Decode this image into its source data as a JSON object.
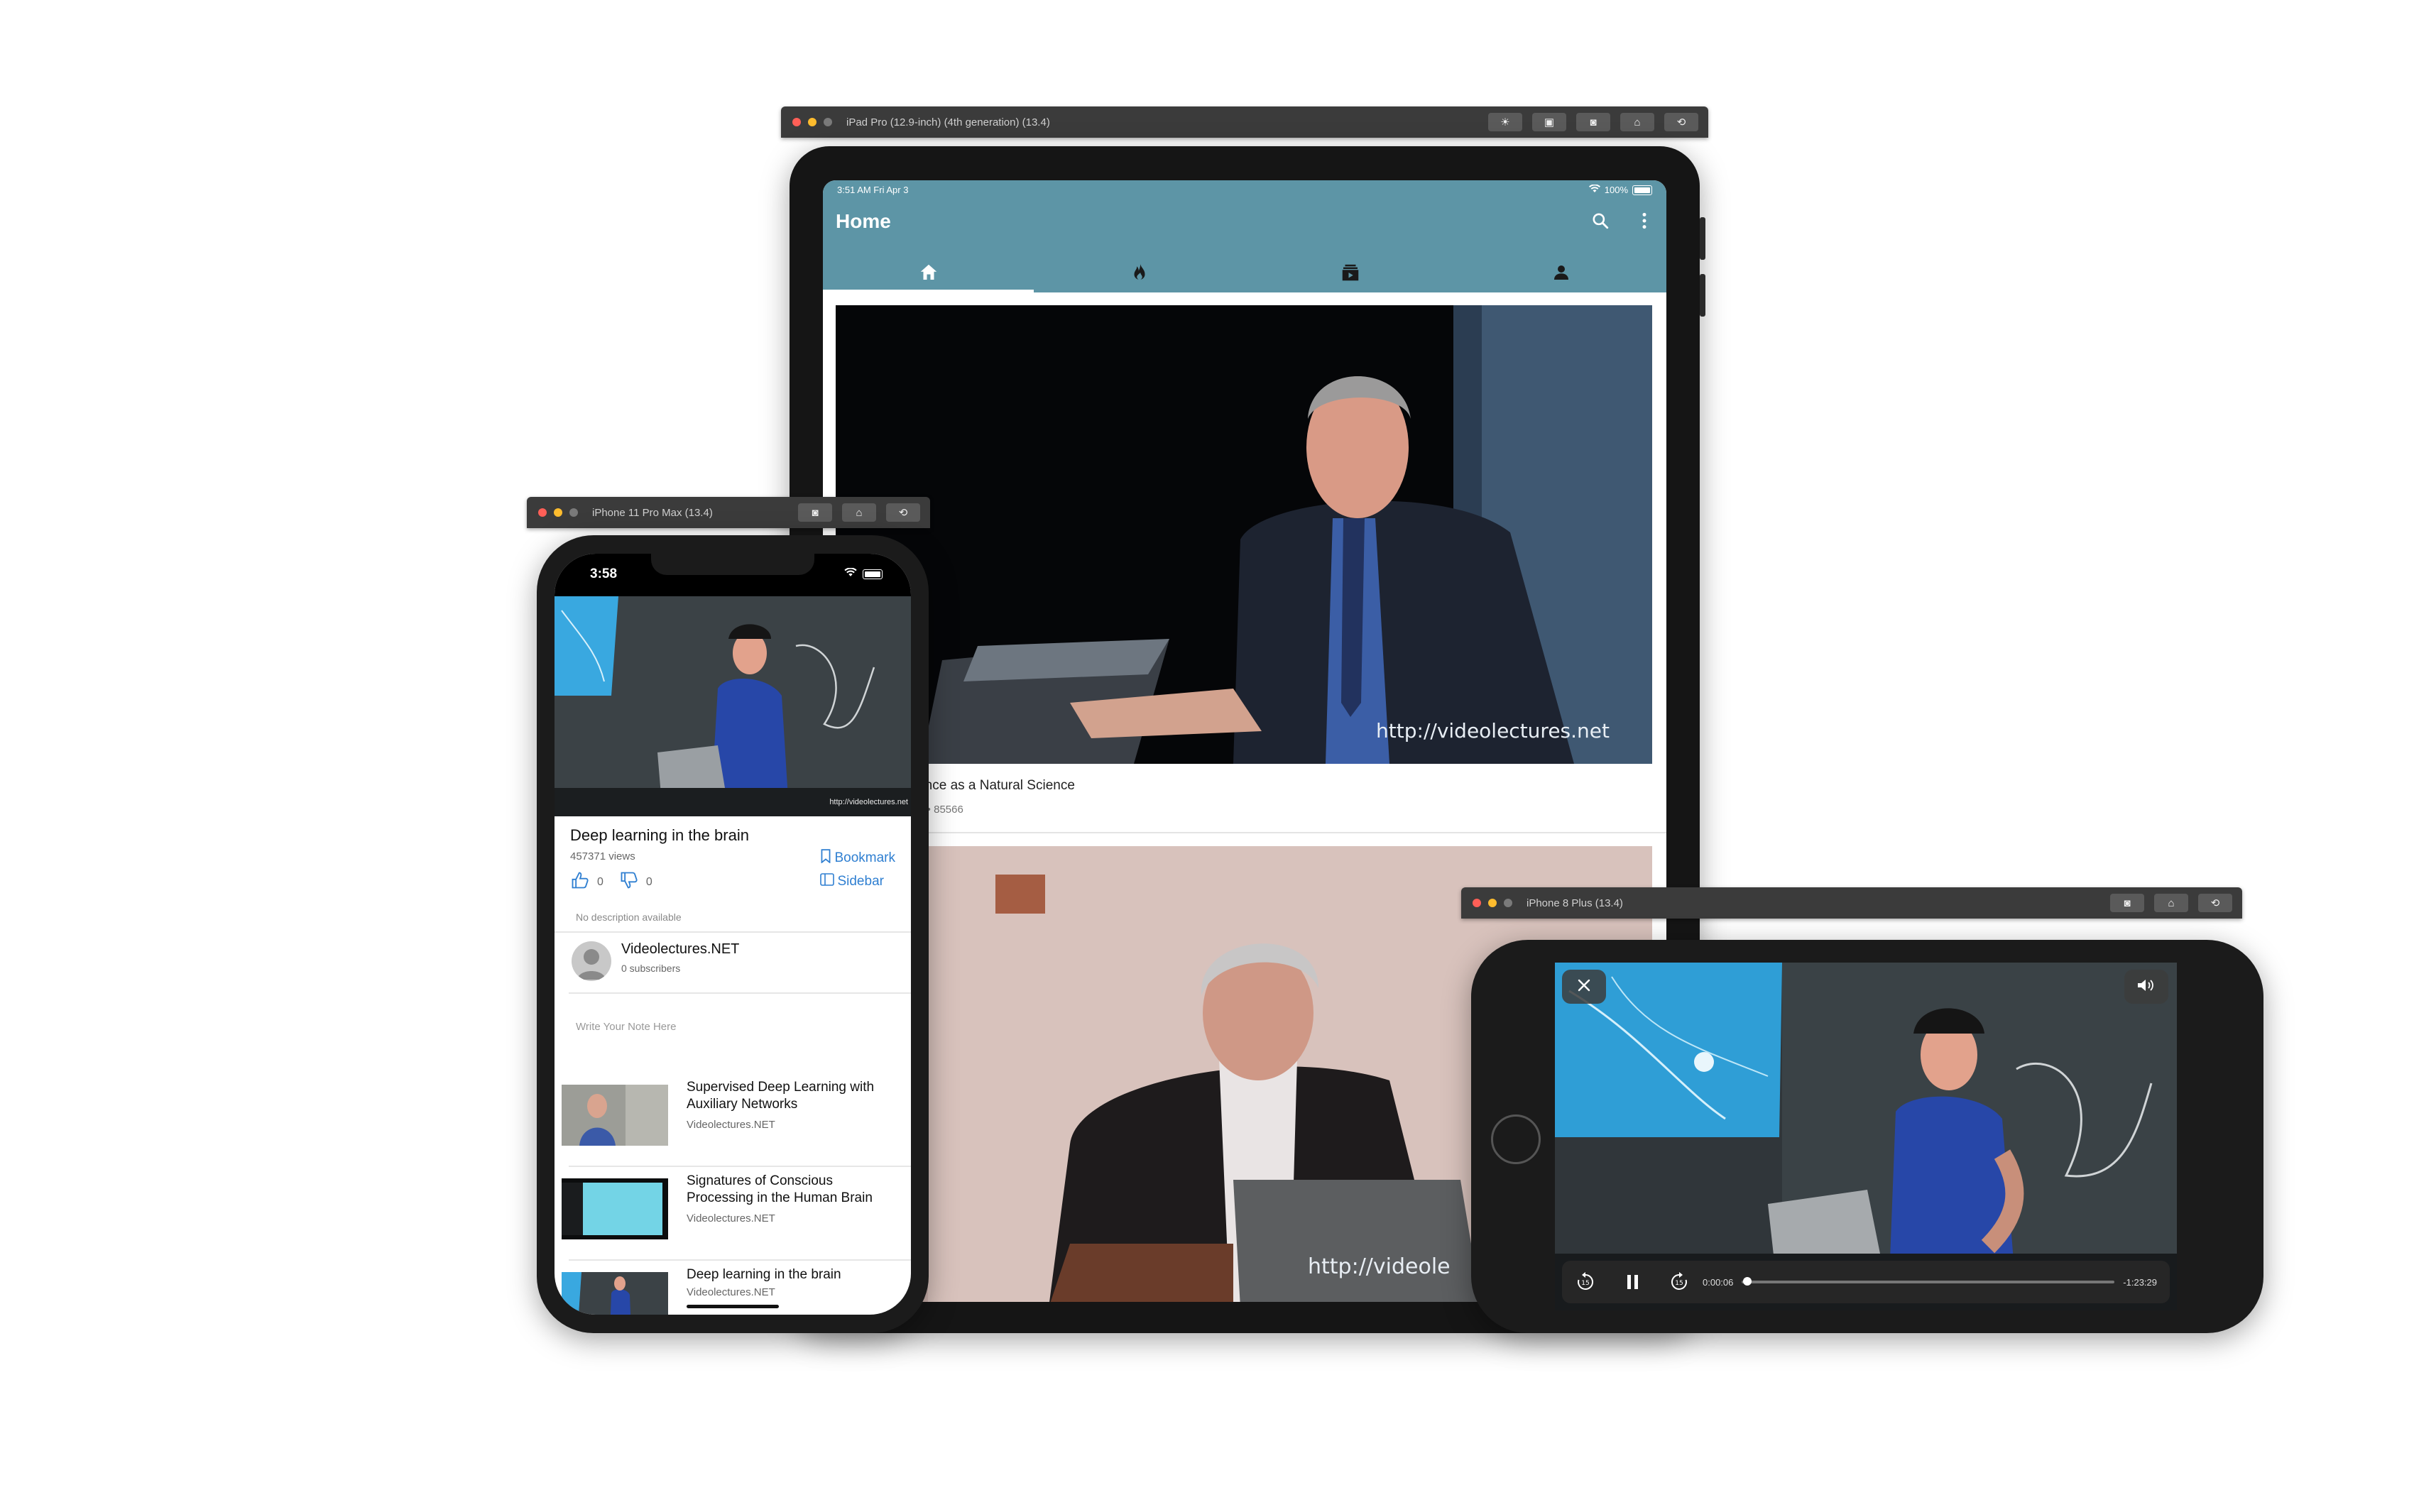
{
  "ipad_sim": {
    "window_title": "iPad Pro (12.9-inch) (4th generation) (13.4)",
    "toolbar_buttons": [
      "brightness-icon",
      "screenshot-icon",
      "camera-icon",
      "home-icon",
      "rotate-icon"
    ],
    "status": {
      "time_date": "3:51 AM   Fri Apr 3",
      "battery": "100%"
    },
    "app_title": "Home",
    "appbar_color": "#5d95a6",
    "tabs": [
      {
        "icon": "home-icon",
        "active": true
      },
      {
        "icon": "fire-icon",
        "active": false
      },
      {
        "icon": "subscriptions-icon",
        "active": false
      },
      {
        "icon": "person-icon",
        "active": false
      }
    ],
    "feed": [
      {
        "title": "Computer Science as a Natural Science",
        "meta": "Videolectures.NET  •  85566",
        "watermark": "http://videolectures.net"
      },
      {
        "title": "",
        "meta": "",
        "watermark": "http://videole"
      }
    ]
  },
  "iphone11_sim": {
    "window_title": "iPhone 11 Pro Max (13.4)",
    "toolbar_buttons": [
      "screenshot-icon",
      "home-icon",
      "rotate-icon"
    ],
    "status": {
      "time": "3:58"
    },
    "video": {
      "watermark": "http://videolectures.net"
    },
    "title": "Deep learning in the brain",
    "views": "457371 views",
    "likes": "0",
    "dislikes": "0",
    "bookmark_label": "Bookmark",
    "sidebar_label": "Sidebar",
    "description": "No description available",
    "channel": {
      "name": "Videolectures.NET",
      "subscribers": "0 subscribers"
    },
    "note_placeholder": "Write Your Note Here",
    "related": [
      {
        "title": "Supervised Deep Learning with Auxiliary Networks",
        "channel": "Videolectures.NET"
      },
      {
        "title": "Signatures of Conscious Processing in the Human Brain",
        "channel": "Videolectures.NET"
      },
      {
        "title": "Deep learning in the brain",
        "channel": "Videolectures.NET"
      }
    ],
    "link_color": "#2f7fd1"
  },
  "iphone8_sim": {
    "window_title": "iPhone 8 Plus (13.4)",
    "toolbar_buttons": [
      "screenshot-icon",
      "home-icon",
      "rotate-icon"
    ],
    "player": {
      "elapsed": "0:00:06",
      "remaining": "-1:23:29",
      "progress_fraction": 0.004,
      "controls": [
        "close-icon",
        "volume-icon",
        "rewind-15-icon",
        "pause-icon",
        "forward-15-icon"
      ]
    }
  }
}
